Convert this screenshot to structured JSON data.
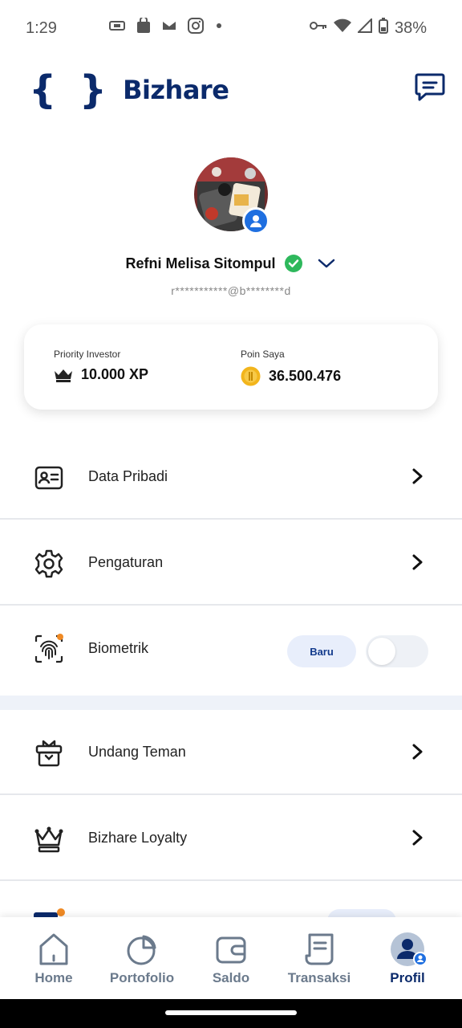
{
  "status_bar": {
    "time": "1:29",
    "battery": "38%"
  },
  "header": {
    "logo_mark": "{ }",
    "logo_text": "Bizhare",
    "chat_icon": "chat-icon"
  },
  "profile": {
    "name": "Refni Melisa Sitompul",
    "email": "r***********@b********d",
    "verified_icon": "check-circle-icon",
    "dropdown_icon": "chevron-down-icon"
  },
  "stats": {
    "tier_label": "Priority Investor",
    "tier_value": "10.000 XP",
    "points_label": "Poin Saya",
    "points_value": "36.500.476"
  },
  "menu": {
    "items": [
      {
        "label": "Data Pribadi",
        "icon": "id-card-icon"
      },
      {
        "label": "Pengaturan",
        "icon": "gear-icon"
      },
      {
        "label": "Biometrik",
        "icon": "fingerprint-icon",
        "badge": "Baru",
        "toggle_on": false
      },
      {
        "label": "Undang Teman",
        "icon": "gift-icon"
      },
      {
        "label": "Bizhare Loyalty",
        "icon": "crown-icon"
      }
    ]
  },
  "bottom_nav": {
    "items": [
      {
        "label": "Home",
        "icon": "home-icon"
      },
      {
        "label": "Portofolio",
        "icon": "pie-chart-icon"
      },
      {
        "label": "Saldo",
        "icon": "wallet-icon"
      },
      {
        "label": "Transaksi",
        "icon": "receipt-icon"
      },
      {
        "label": "Profil",
        "icon": "profile-icon"
      }
    ],
    "active_index": 4
  },
  "colors": {
    "brand": "#0b2a6b",
    "accent": "#1f6fe0",
    "verified": "#2eb85c",
    "coin": "#f2b51c",
    "notification_dot": "#f08a24"
  }
}
